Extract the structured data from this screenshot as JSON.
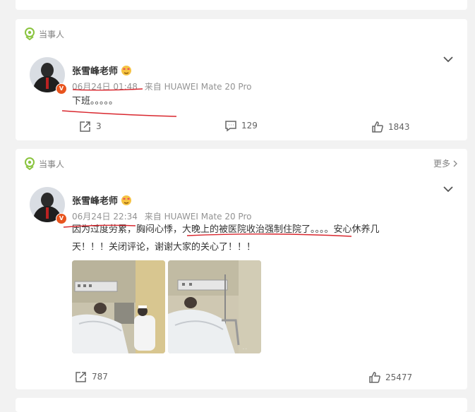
{
  "post1": {
    "tag": "当事人",
    "author": "张雪峰老师",
    "time": "06月24日 01:48",
    "source": "来自 HUAWEI Mate 20 Pro",
    "text": "下班。。。。。",
    "reposts": "3",
    "comments": "129",
    "likes": "1843"
  },
  "post2": {
    "tag": "当事人",
    "more": "更多",
    "author": "张雪峰老师",
    "time": "06月24日 22:34",
    "source": "来自 HUAWEI Mate 20 Pro",
    "text_line1": "因为过度劳累，胸闷心悸，大晚上的被医院收治强制住院了。。。。安心休养几",
    "text_line2": "天！！！关闭评论，谢谢大家的关心了！！！",
    "reposts": "787",
    "likes": "25477"
  },
  "icons": [
    "location-tag-icon",
    "chevron-down-icon",
    "verified-badge-icon",
    "emoji-icon",
    "repost-icon",
    "comment-icon",
    "like-icon",
    "chevron-right-icon"
  ],
  "colors": {
    "tag": "#8ac43f",
    "badge": "#e8541e",
    "underline": "#d9272e",
    "text": "#333333",
    "meta": "#939393"
  }
}
